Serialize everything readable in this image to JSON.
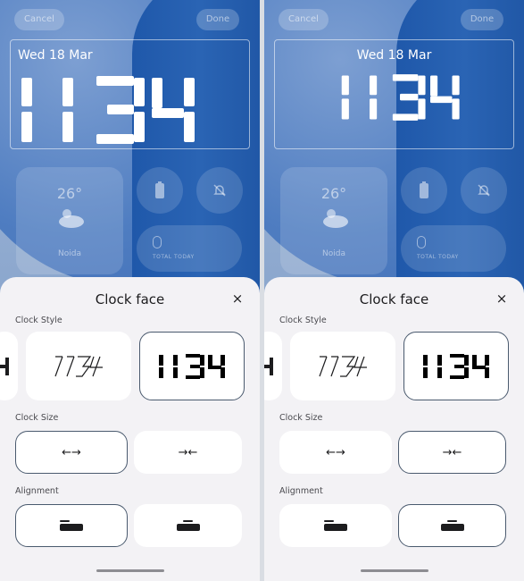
{
  "panels": [
    {
      "id": "left",
      "top_bar": {
        "cancel_label": "Cancel",
        "done_label": "Done"
      },
      "lock": {
        "date": "Wed 18 Mar",
        "time": "1134"
      },
      "widgets": {
        "temp": "26°",
        "city": "Noida",
        "steps_label": "TOTAL TODAY"
      },
      "sheet": {
        "title": "Clock face",
        "clock_style_label": "Clock Style",
        "clock_size_label": "Clock Size",
        "alignment_label": "Alignment",
        "styles": [
          "1134",
          "1134"
        ],
        "size_options": [
          "↔ large",
          "→← small"
        ],
        "selected_style": 1,
        "selected_size": 0,
        "selected_alignment": 0
      }
    },
    {
      "id": "right",
      "top_bar": {
        "cancel_label": "Cancel",
        "done_label": "Done"
      },
      "lock": {
        "date": "Wed 18 Mar",
        "time": "1134"
      },
      "widgets": {
        "temp": "26°",
        "city": "Noida",
        "steps_label": "TOTAL TODAY"
      },
      "sheet": {
        "title": "Clock face",
        "clock_style_label": "Clock Style",
        "clock_size_label": "Clock Size",
        "alignment_label": "Alignment",
        "styles": [
          "1134",
          "1134"
        ],
        "selected_style": 1,
        "selected_size": 1,
        "selected_alignment": 1
      }
    }
  ],
  "icons": {
    "close": "×",
    "expand": "←→",
    "shrink": "→←"
  },
  "colors": {
    "accent_border": "#4a5a6e",
    "wallpaper_blue": "#2a64b4",
    "sheet_bg": "#f3f2f5"
  }
}
